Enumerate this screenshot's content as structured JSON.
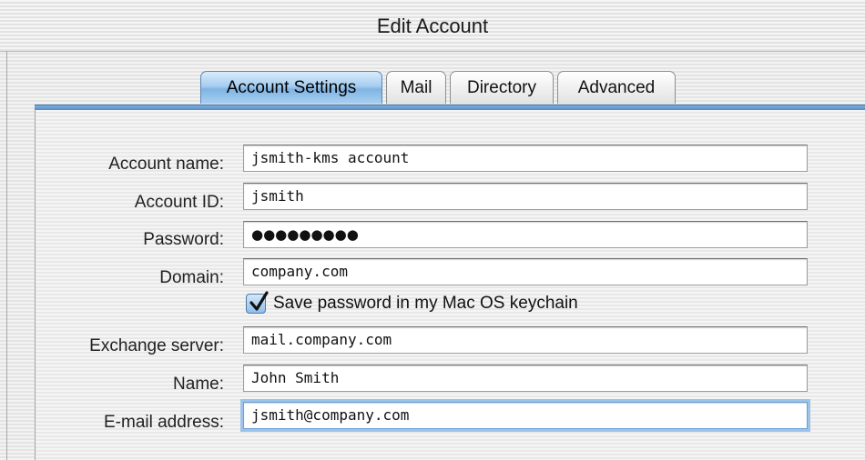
{
  "window": {
    "title": "Edit Account"
  },
  "tabs": [
    {
      "label": "Account Settings",
      "active": true
    },
    {
      "label": "Mail",
      "active": false
    },
    {
      "label": "Directory",
      "active": false
    },
    {
      "label": "Advanced",
      "active": false
    }
  ],
  "form": {
    "account_name": {
      "label": "Account name:",
      "value": "jsmith-kms account"
    },
    "account_id": {
      "label": "Account ID:",
      "value": "jsmith"
    },
    "password": {
      "label": "Password:",
      "value": "●●●●●●●●●"
    },
    "domain": {
      "label": "Domain:",
      "value": "company.com"
    },
    "save_keychain": {
      "label": "Save password in my Mac OS keychain",
      "checked": true
    },
    "exchange_server": {
      "label": "Exchange server:",
      "value": "mail.company.com"
    },
    "name": {
      "label": "Name:",
      "value": "John Smith"
    },
    "email": {
      "label": "E-mail address:",
      "value": "jsmith@company.com"
    }
  },
  "colors": {
    "accent": "#7fb4e4",
    "tab_bar": "#4a84c2",
    "focus_ring": "#9cc3ea"
  }
}
